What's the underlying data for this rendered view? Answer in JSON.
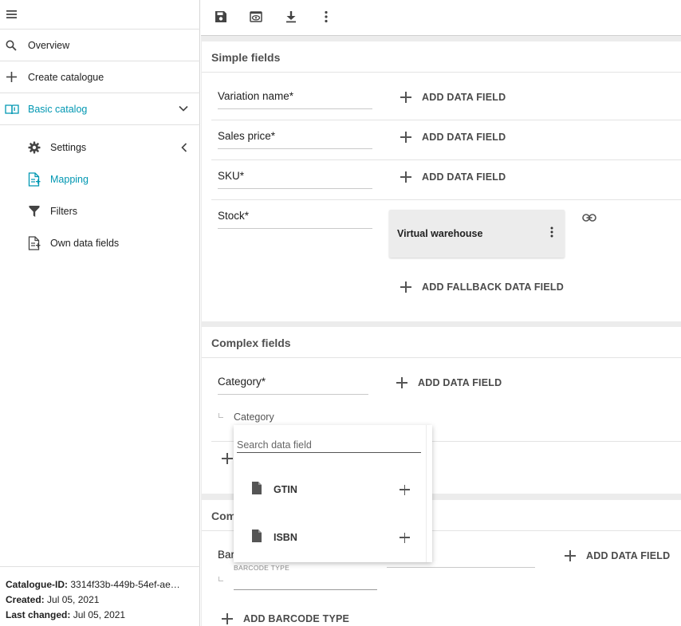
{
  "sidebar": {
    "items": [
      {
        "label": "Overview",
        "icon": "search-icon"
      },
      {
        "label": "Create catalogue",
        "icon": "plus-icon"
      },
      {
        "label": "Basic catalog",
        "icon": "book-icon"
      },
      {
        "label": "Settings",
        "icon": "gear-icon"
      },
      {
        "label": "Mapping",
        "icon": "file-mapping-icon"
      },
      {
        "label": "Filters",
        "icon": "filter-icon"
      },
      {
        "label": "Own data fields",
        "icon": "file-plus-icon"
      }
    ],
    "footer": {
      "id_label": "Catalogue-ID:",
      "id_value": "3314f33b-449b-54ef-ae…",
      "created_label": "Created:",
      "created_value": "Jul 05, 2021",
      "changed_label": "Last changed:",
      "changed_value": "Jul 05, 2021"
    }
  },
  "toolbar": {
    "icons": [
      "save-icon",
      "preview-icon",
      "download-icon",
      "more-vert-icon"
    ]
  },
  "simple_fields": {
    "title": "Simple fields",
    "rows": [
      {
        "label": "Variation name*",
        "action": "ADD DATA FIELD"
      },
      {
        "label": "Sales price*",
        "action": "ADD DATA FIELD"
      },
      {
        "label": "SKU*",
        "action": "ADD DATA FIELD"
      },
      {
        "label": "Stock*",
        "chip": "Virtual warehouse",
        "action": "ADD FALLBACK DATA FIELD"
      }
    ]
  },
  "complex_fields": {
    "title": "Complex fields",
    "rows": [
      {
        "label": "Category*",
        "action": "ADD DATA FIELD",
        "sub_item": "Category"
      }
    ]
  },
  "third_card": {
    "title": "Com",
    "row_label": "Bar",
    "action": "ADD DATA FIELD",
    "barcode_type_label": "BARCODE TYPE",
    "add_barcode": "ADD BARCODE TYPE"
  },
  "dropdown": {
    "search_placeholder": "Search data field",
    "items": [
      {
        "label": "GTIN"
      },
      {
        "label": "ISBN"
      }
    ]
  },
  "colors": {
    "accent": "#0097b2",
    "background": "#ececec"
  }
}
